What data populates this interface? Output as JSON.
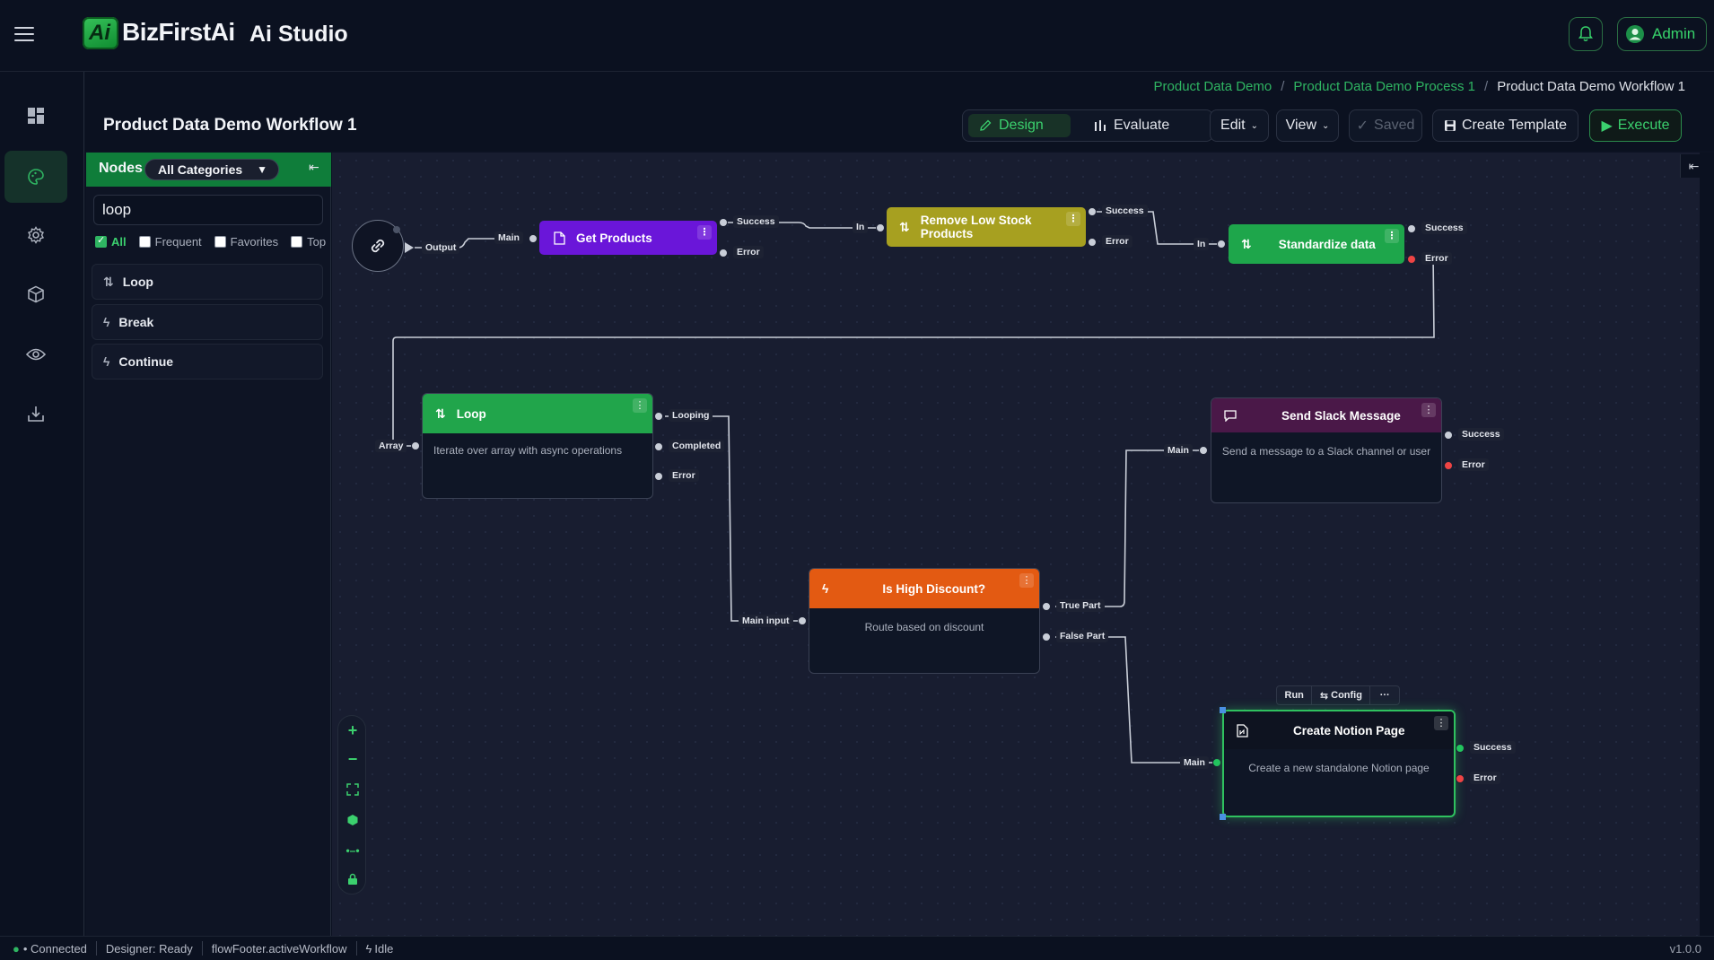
{
  "app": {
    "brand": "BizFirstAi",
    "logo_letter": "Ai",
    "studio": "Ai Studio",
    "user": "Admin"
  },
  "breadcrumb": [
    "Product Data Demo",
    "Product Data Demo Process 1",
    "Product Data Demo Workflow 1"
  ],
  "page_title": "Product Data Demo Workflow 1",
  "toolbar": {
    "design": "Design",
    "evaluate": "Evaluate",
    "edit": "Edit",
    "view": "View",
    "saved": "Saved",
    "create_template": "Create Template",
    "execute": "Execute"
  },
  "panel": {
    "title": "Nodes",
    "category": "All Categories",
    "search_value": "loop",
    "filters": [
      {
        "label": "All",
        "checked": true
      },
      {
        "label": "Frequent",
        "checked": false
      },
      {
        "label": "Favorites",
        "checked": false
      },
      {
        "label": "Top",
        "checked": false
      }
    ],
    "items": [
      {
        "label": "Loop"
      },
      {
        "label": "Break"
      },
      {
        "label": "Continue"
      }
    ]
  },
  "nodes": {
    "get_products": {
      "title": "Get Products",
      "color": "#6a16d9"
    },
    "remove_low_stock": {
      "title": "Remove Low Stock Products",
      "color": "#a7a020"
    },
    "standardize": {
      "title": "Standardize data",
      "color": "#1ea64b"
    },
    "loop": {
      "title": "Loop",
      "desc": "Iterate over array with async operations",
      "color": "#21a54b"
    },
    "high_discount": {
      "title": "Is High Discount?",
      "desc": "Route based on discount",
      "color": "#e35a12"
    },
    "slack": {
      "title": "Send Slack Message",
      "desc": "Send a message to a Slack channel or user",
      "color": "#4a1848"
    },
    "notion": {
      "title": "Create Notion Page",
      "desc": "Create a new standalone Notion page",
      "color": "#0e1320"
    }
  },
  "ports": {
    "output": "Output",
    "main": "Main",
    "success": "Success",
    "error": "Error",
    "in": "In",
    "array": "Array",
    "looping": "Looping",
    "completed": "Completed",
    "main_input": "Main input",
    "true_part": "True Part",
    "false_part": "False Part"
  },
  "node_actions": {
    "run": "Run",
    "config": "Config",
    "more": "···"
  },
  "footer": {
    "connected": "• Connected",
    "designer": "Designer: Ready",
    "active": "flowFooter.activeWorkflow",
    "idle": "Idle",
    "version": "v1.0.0"
  },
  "icons": [
    "hamburger-icon",
    "bell-icon",
    "user-icon",
    "dashboard-icon",
    "palette-icon",
    "gear-icon",
    "cube-icon",
    "eye-icon",
    "download-icon",
    "link-icon"
  ]
}
